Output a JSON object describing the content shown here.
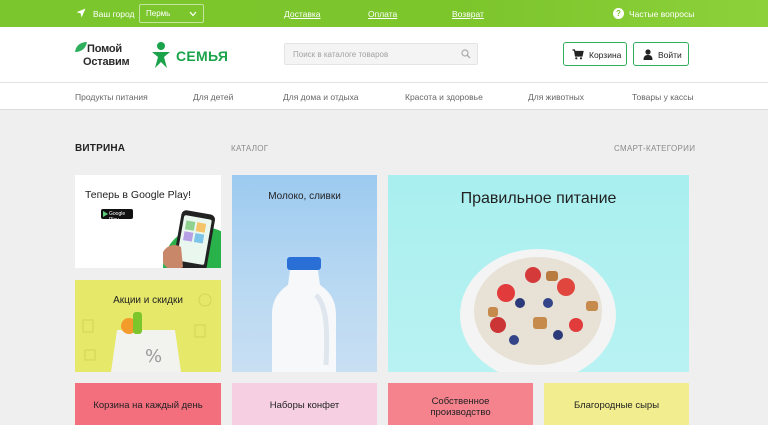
{
  "topbar": {
    "city_label": "Ваш город",
    "city_value": "Пермь",
    "links": [
      "Доставка",
      "Оплата",
      "Возврат"
    ],
    "faq": "Частые вопросы"
  },
  "header": {
    "logo_line1": "Помой",
    "logo_line2": "Оставим",
    "brand": "СЕМЬЯ",
    "search_placeholder": "Поиск в каталоге товаров",
    "cart_label": "Корзина",
    "login_label": "Войти"
  },
  "categories": [
    "Продукты питания",
    "Для детей",
    "Для дома и отдыха",
    "Красота и здоровье",
    "Для животных",
    "Товары у кассы"
  ],
  "section": {
    "title": "ВИТРИНА",
    "catalog": "КАТАЛОГ",
    "smart": "СМАРТ-КАТЕГОРИИ"
  },
  "tiles": {
    "google_play": "Теперь в Google Play!",
    "google_play_badge": "Google Play",
    "promo": "Акции и скидки",
    "milk": "Молоко, сливки",
    "healthy": "Правильное питание",
    "basket": "Корзина на каждый день",
    "candy": "Наборы конфет",
    "own_line1": "Собственное",
    "own_line2": "производство",
    "cheese": "Благородные сыры"
  },
  "colors": {
    "brand_green": "#7cc52b",
    "button_border": "#2fae5b"
  }
}
